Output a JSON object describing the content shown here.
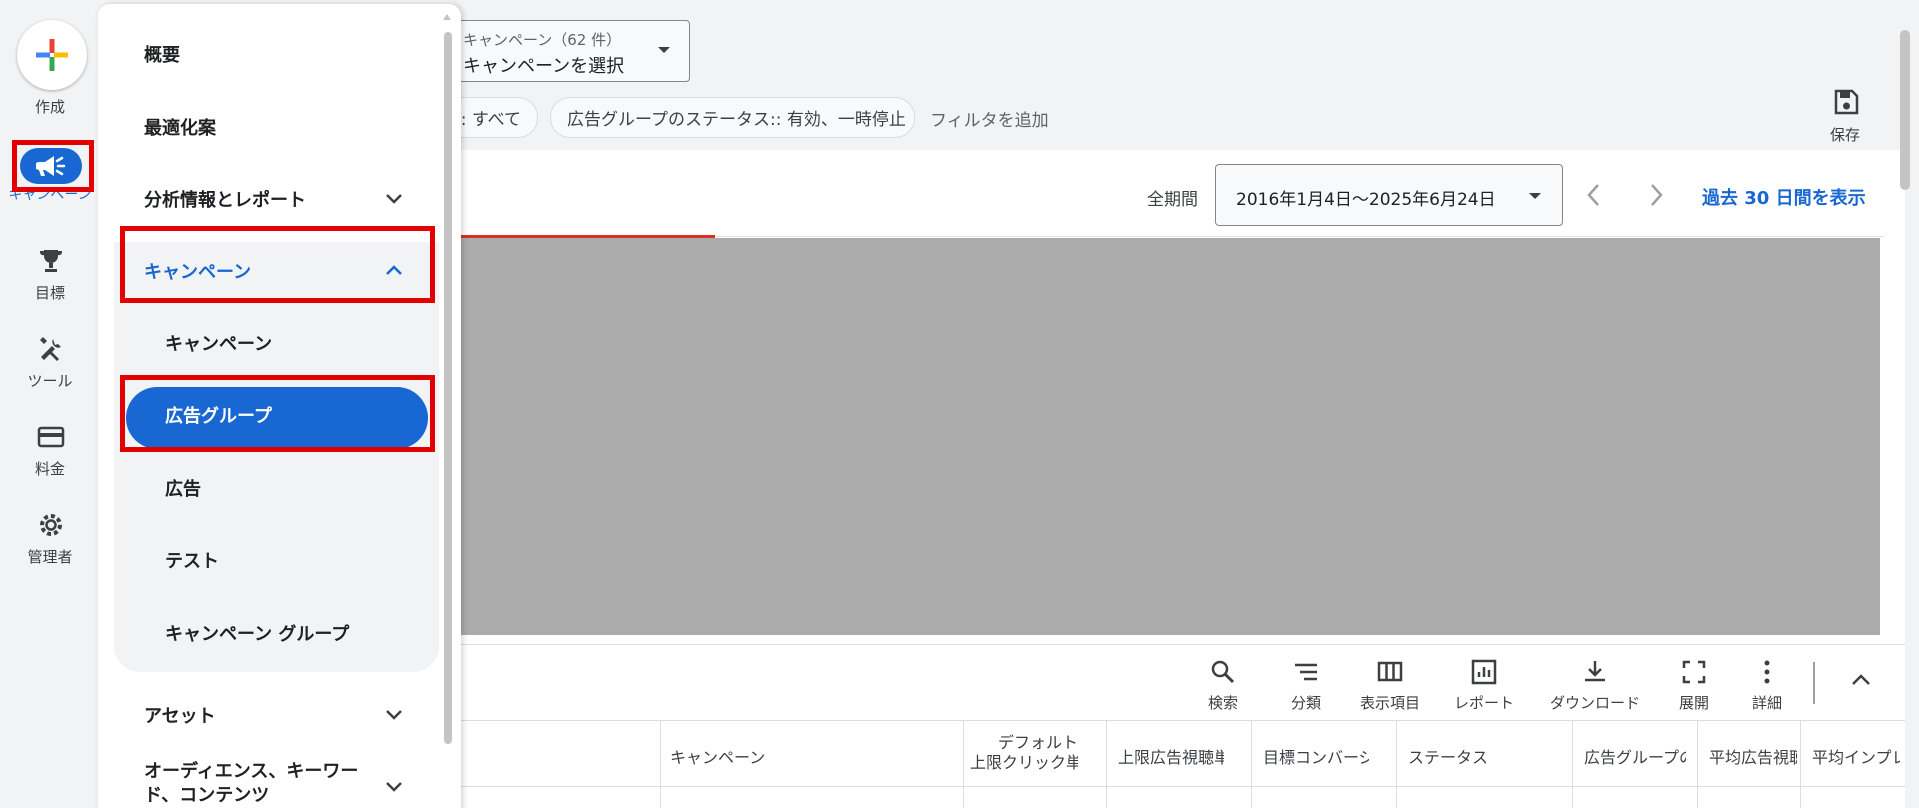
{
  "rail": {
    "create_label": "作成",
    "campaigns_label": "キャンペーン",
    "goals_label": "目標",
    "tools_label": "ツール",
    "billing_label": "料金",
    "admin_label": "管理者"
  },
  "drawer": {
    "overview": "概要",
    "recommendations": "最適化案",
    "insights": "分析情報とレポート",
    "campaigns_section": "キャンペーン",
    "sub_campaigns": "キャンペーン",
    "sub_adgroups": "広告グループ",
    "sub_ads": "広告",
    "sub_experiments": "テスト",
    "sub_campaign_groups": "キャンペーン グループ",
    "assets": "アセット",
    "audiences_line1": "オーディエンス、キーワー",
    "audiences_line2": "ド、コンテンツ"
  },
  "header": {
    "campaign_select_caption": "キャンペーン（62 件）",
    "campaign_select_value": "キャンペーンを選択",
    "filter_chip_1": ":: すべて",
    "filter_chip_2": "広告グループのステータス:: 有効、一時停止",
    "add_filter": "フィルタを追加",
    "save_label": "保存"
  },
  "daterange": {
    "period_label": "全期間",
    "range": "2016年1月4日〜2025年6月24日",
    "show_last_30": "過去 30 日間を表示"
  },
  "toolbar": {
    "search": "検索",
    "segment": "分類",
    "columns": "表示項目",
    "reports": "レポート",
    "download": "ダウンロード",
    "expand": "展開",
    "more": "詳細"
  },
  "table_headers": {
    "campaign": "キャンペーン",
    "default_line1": "デフォルト",
    "default_line2": "上限クリック単",
    "max_cpv": "上限広告視聴単",
    "target_cpa": "目標コンバージ",
    "status": "ステータス",
    "adgroup_type": "広告グループの",
    "avg_cpv": "平均広告視聴",
    "avg_cpm": "平均インプレ"
  },
  "colors": {
    "accent": "#1967d2",
    "highlight_box": "#e50000",
    "chart_placeholder": "#ababab"
  }
}
